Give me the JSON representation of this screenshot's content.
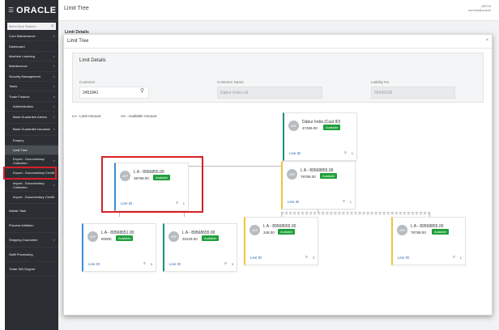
{
  "header": {
    "page_title": "Limit Tree",
    "user_name": "ARTHI",
    "user_email": "someid@oracle"
  },
  "sidebar": {
    "logo": "ORACLE",
    "search_placeholder": "Menu Item Search...",
    "items": [
      {
        "label": "Core Maintenance",
        "arrow": ">"
      },
      {
        "label": "Dashboard",
        "arrow": ""
      },
      {
        "label": "Machine Learning",
        "arrow": ">"
      },
      {
        "label": "Maintenance",
        "arrow": ">"
      },
      {
        "label": "Security Management",
        "arrow": ">"
      },
      {
        "label": "Tasks",
        "arrow": ">"
      },
      {
        "label": "Trade Finance",
        "arrow": "v"
      },
      {
        "label": "Administration",
        "arrow": ">"
      },
      {
        "label": "Bank Guarantee Advice",
        "arrow": ">"
      },
      {
        "label": "Bank Guarantee Issuance",
        "arrow": ">"
      },
      {
        "label": "Enquiry",
        "arrow": ""
      },
      {
        "label": "Limit Tree",
        "arrow": ""
      },
      {
        "label": "Export - Documentary Collection",
        "arrow": ">"
      },
      {
        "label": "Export - Documentary Credit",
        "arrow": ">"
      },
      {
        "label": "Import - Documentary Collection",
        "arrow": ">"
      },
      {
        "label": "Import - Documentary Credit",
        "arrow": ">"
      },
      {
        "label": "Initiate Task",
        "arrow": ""
      },
      {
        "label": "Process Initiation",
        "arrow": ""
      },
      {
        "label": "Shipping Guarantee",
        "arrow": ">"
      },
      {
        "label": "Swift Processing",
        "arrow": ""
      },
      {
        "label": "Trade 360 Degree",
        "arrow": ""
      }
    ]
  },
  "background": {
    "breadcrumb": "Limit Details"
  },
  "dialog": {
    "title": "Limit Tree",
    "close": "×",
    "section_title": "Limit Details",
    "customer_label": "Customer",
    "customer_value": "2451841",
    "customer_name_label": "Customer Name",
    "customer_name_value": "Dabur India Ltd",
    "liability_label": "Liability No",
    "liability_value": "56439159",
    "legend_la": "LA - Limit Amount",
    "legend_aa": "AA - Available Amount"
  },
  "tree": {
    "root": {
      "avatar": "UBP",
      "name": "Dabur India (Cust ID)",
      "amount": "47459.00",
      "status": "Available",
      "line_id": "Line ID",
      "count": "1"
    },
    "level1": [
      {
        "avatar": "UBP",
        "name": "L A - 8956855.00",
        "amount": "38789.00",
        "status": "Available",
        "line_id": "Line ID",
        "count": "1"
      },
      {
        "avatar": "UBP",
        "name": "L A - 89568855.00",
        "amount": "78788.00",
        "status": "Available",
        "line_id": "Line ID",
        "count": "1"
      }
    ],
    "level2": [
      {
        "avatar": "UBP",
        "name": "L A - 89568651.00",
        "amount": "80000",
        "status": "Available",
        "line_id": "Line ID",
        "count": "3"
      },
      {
        "avatar": "UBP",
        "name": "L A - 89568655.00",
        "amount": "32429.00",
        "status": "Available",
        "line_id": "Line ID",
        "count": "3"
      },
      {
        "avatar": "UBP",
        "name": "L A - 89568655.00",
        "amount": "348.00",
        "status": "Available",
        "line_id": "Line ID",
        "count": "3"
      },
      {
        "avatar": "UBP",
        "name": "L A - 89568855.00",
        "amount": "78788.00",
        "status": "Available",
        "line_id": "Line ID",
        "count": "1"
      }
    ]
  }
}
